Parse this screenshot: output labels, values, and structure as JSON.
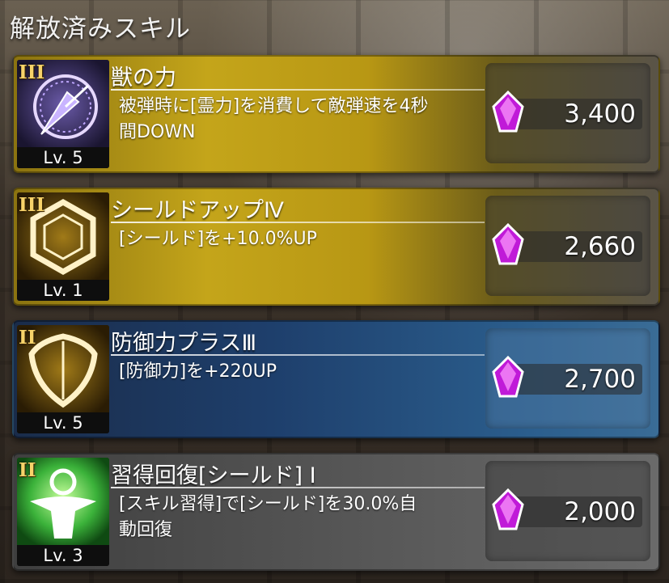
{
  "header": {
    "title": "解放済みスキル"
  },
  "colors": {
    "gold_card": "#c4a51a",
    "blue_card": "#1e3f6c",
    "gray_card": "#555555",
    "gem": "#c01ad8"
  },
  "skills": [
    {
      "rank": "III",
      "level": "Lv. 5",
      "name": "獣の力",
      "desc_line1": "被弾時に[霊力]を消費して敵弾速を4秒",
      "desc_line2": "間DOWN",
      "cost": "3,400",
      "icon": "clock-arrow-icon",
      "style": "gold"
    },
    {
      "rank": "III",
      "level": "Lv. 1",
      "name": "シールドアップⅣ",
      "desc_line1": "[シールド]を+10.0%UP",
      "desc_line2": "",
      "cost": "2,660",
      "icon": "hexagon-shield-icon",
      "style": "gold"
    },
    {
      "rank": "II",
      "level": "Lv. 5",
      "name": "防御力プラスⅢ",
      "desc_line1": "[防御力]を+220UP",
      "desc_line2": "",
      "cost": "2,700",
      "icon": "shield-icon",
      "style": "blue"
    },
    {
      "rank": "II",
      "level": "Lv. 3",
      "name": "習得回復[シールド] Ⅰ",
      "desc_line1": "[スキル習得]で[シールド]を30.0%自",
      "desc_line2": "動回復",
      "cost": "2,000",
      "icon": "person-heal-icon",
      "style": "gray"
    }
  ]
}
